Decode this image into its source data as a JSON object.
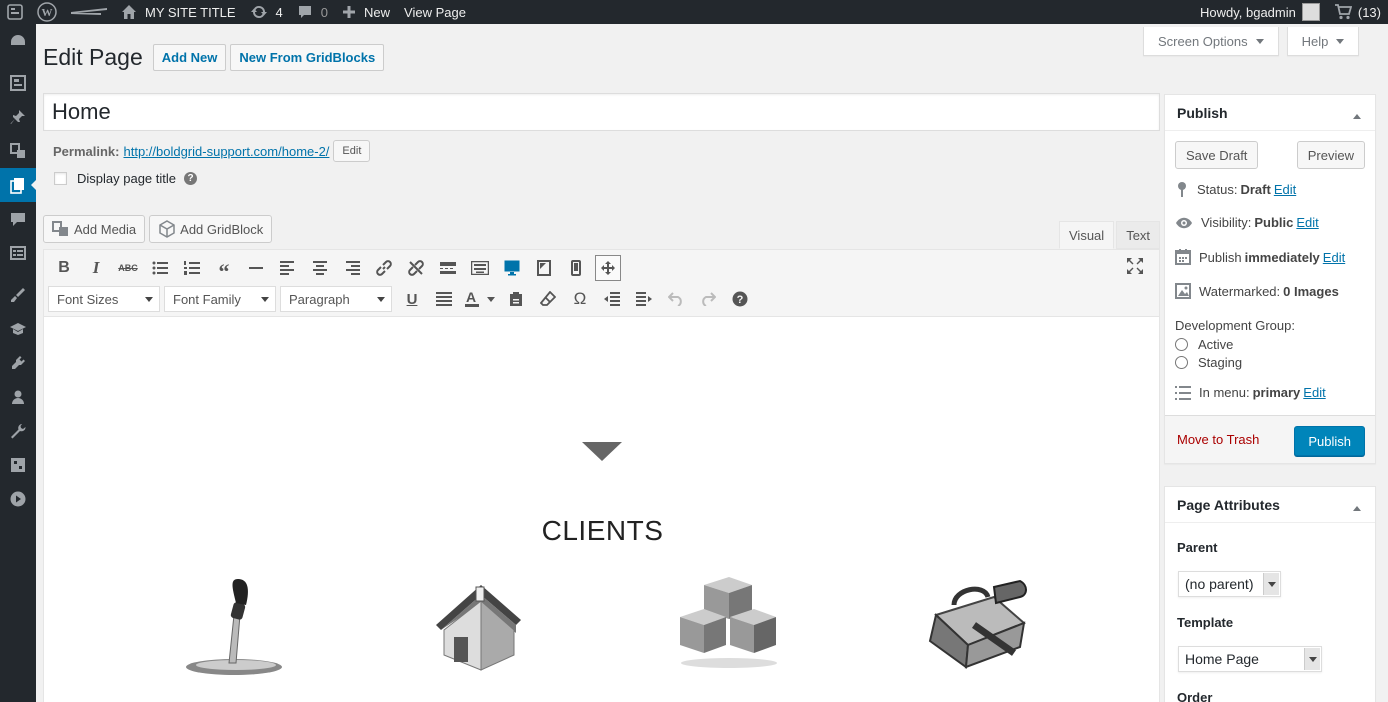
{
  "adminbar": {
    "site_title": "MY SITE TITLE",
    "updates_count": "4",
    "comments_count": "0",
    "new_label": "New",
    "view_label": "View Page",
    "greeting": "Howdy, bgadmin",
    "cart_count": "(13)"
  },
  "screen_meta": {
    "screen_options": "Screen Options",
    "help": "Help"
  },
  "heading": {
    "title": "Edit Page",
    "add_new": "Add New",
    "new_from_gridblocks": "New From GridBlocks"
  },
  "post": {
    "title": "Home",
    "permalink_label": "Permalink:",
    "permalink_url": "http://boldgrid-support.com/home-2/",
    "permalink_edit": "Edit",
    "display_title_label": "Display page title"
  },
  "editor": {
    "add_media": "Add Media",
    "add_gridblock": "Add GridBlock",
    "tab_visual": "Visual",
    "tab_text": "Text",
    "font_sizes": "Font Sizes",
    "font_family": "Font Family",
    "paragraph": "Paragraph"
  },
  "content": {
    "heading": "CLIENTS"
  },
  "publish_box": {
    "title": "Publish",
    "save_draft": "Save Draft",
    "preview": "Preview",
    "status_label": "Status:",
    "status_value": "Draft",
    "visibility_label": "Visibility:",
    "visibility_value": "Public",
    "publish_label": "Publish",
    "publish_value": "immediately",
    "watermarked_label": "Watermarked:",
    "watermarked_value": "0 Images",
    "edit_link": "Edit",
    "dev_group_label": "Development Group:",
    "dev_group_options": [
      "Active",
      "Staging"
    ],
    "in_menu_label": "In menu:",
    "in_menu_value": "primary",
    "trash": "Move to Trash",
    "publish_button": "Publish"
  },
  "attributes_box": {
    "title": "Page Attributes",
    "parent_label": "Parent",
    "parent_value": "(no parent)",
    "template_label": "Template",
    "template_value": "Home Page",
    "order_label": "Order"
  },
  "colors": {
    "admin_bar": "#23282d",
    "accent": "#0073aa",
    "publish_button": "#0085ba",
    "trash": "#a00"
  }
}
